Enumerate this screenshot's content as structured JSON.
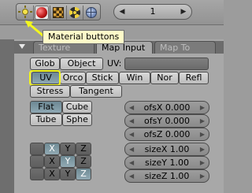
{
  "header": {
    "icons": [
      {
        "name": "lamp-icon",
        "selected": false
      },
      {
        "name": "material-sphere-icon",
        "selected": true
      },
      {
        "name": "texture-checker-icon",
        "selected": false
      },
      {
        "name": "radiosity-icon",
        "selected": false
      },
      {
        "name": "world-globe-icon",
        "selected": false
      }
    ],
    "stepper_value": "1",
    "left_arrow": "◀",
    "right_arrow": "▶"
  },
  "tooltip": "Material buttons",
  "tabs": {
    "texture": "Texture",
    "map_input": "Map Input",
    "map_to": "Map To",
    "active": "Map Input"
  },
  "map_input": {
    "row1": {
      "glob": "Glob",
      "object": "Object",
      "uv_label": "UV:"
    },
    "row2": [
      "UV",
      "Orco",
      "Stick",
      "Win",
      "Nor",
      "Refl"
    ],
    "row2_active": "UV",
    "row3": [
      "Stress",
      "Tangent"
    ],
    "projection": [
      "Flat",
      "Cube",
      "Tube",
      "Sphe"
    ],
    "projection_active": "Flat",
    "offsets": [
      {
        "label": "ofsX 0.000"
      },
      {
        "label": "ofsY 0.000"
      },
      {
        "label": "ofsZ 0.000"
      }
    ],
    "mapping_rows": [
      [
        "X",
        "Y",
        "Z"
      ],
      [
        "X",
        "Y",
        "Z"
      ],
      [
        "X",
        "Y",
        "Z"
      ]
    ],
    "mapping_active": [
      "X",
      "Y",
      "Z"
    ],
    "sizes": [
      {
        "label": "sizeX 1.00"
      },
      {
        "label": "sizeY 1.00"
      },
      {
        "label": "sizeZ 1.00"
      }
    ]
  },
  "colors": {
    "highlight": "#f3f71d",
    "tooltip_bg": "#fffbc9",
    "active_button": "#7d98a3"
  }
}
